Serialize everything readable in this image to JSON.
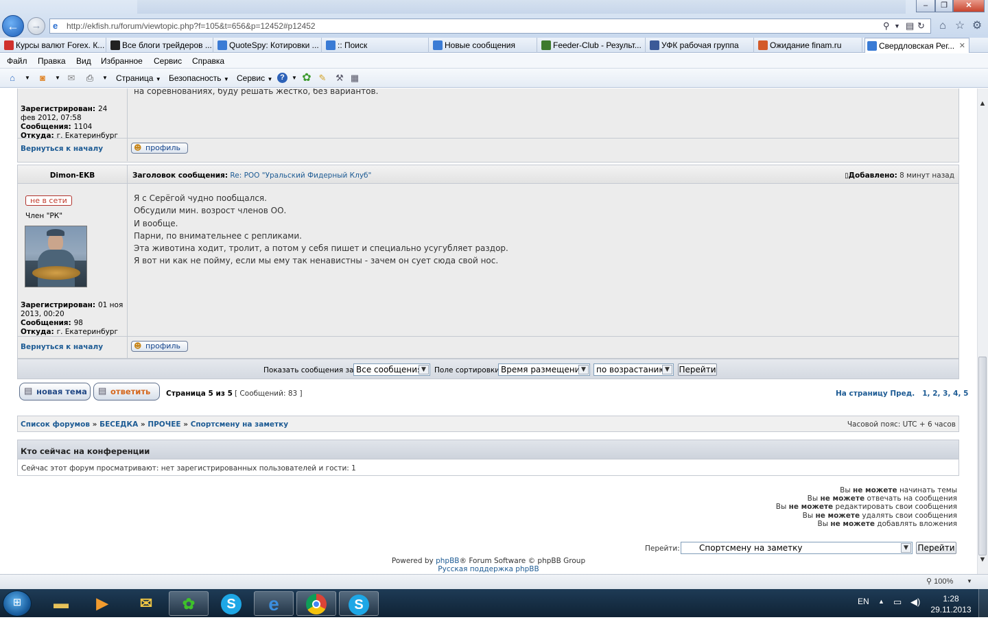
{
  "browser": {
    "url": "http://ekfish.ru/forum/viewtopic.php?f=105&t=656&p=12452#p12452",
    "window_buttons": [
      "–",
      "❐",
      "✕"
    ]
  },
  "favorites": [
    {
      "label": "Курсы валют Forex. К...",
      "color": "#d0312d"
    },
    {
      "label": "Все блоги трейдеров ...",
      "color": "#222222"
    },
    {
      "label": "QuoteSpy: Котировки ...",
      "color": "#3a7bd5"
    },
    {
      "label": ":: Поиск",
      "color": "#3a7bd5"
    },
    {
      "label": "Новые сообщения",
      "color": "#3a7bd5"
    },
    {
      "label": "Feeder-Club - Результ...",
      "color": "#3d7a2c"
    },
    {
      "label": "УФК рабочая группа",
      "color": "#3b5998"
    },
    {
      "label": "Ожидание finam.ru",
      "color": "#d35a2a"
    },
    {
      "label": "Свердловская Рег...",
      "color": "#3a7bd5"
    }
  ],
  "menu": [
    "Файл",
    "Правка",
    "Вид",
    "Избранное",
    "Сервис",
    "Справка"
  ],
  "commands": [
    "Страница",
    "Безопасность",
    "Сервис"
  ],
  "post1": {
    "body_tail": "на соревнованиях, буду решать жёстко, без вариантов.",
    "registered_label": "Зарегистрирован:",
    "registered_value": "24 фев 2012, 07:58",
    "posts_label": "Сообщения:",
    "posts_value": "1104",
    "from_label": "Откуда:",
    "from_value": "г. Екатеринбург",
    "back_to_top": "Вернуться к началу",
    "profile_btn": "профиль"
  },
  "post2": {
    "author": "Dimon-EKB",
    "subject_label": "Заголовок сообщения:",
    "subject_value": "Re: РОО \"Уральский Фидерный Клуб\"",
    "added_label": "Добавлено:",
    "added_value": "8 минут назад",
    "status": "не в сети",
    "rank": "Член \"РК\"",
    "lines": [
      "Я с Серёгой чудно пообщался.",
      "Обсудили мин. возрост членов ОО.",
      "И вообще.",
      "Парни, по внимательнее с репликами.",
      "Эта животина ходит, тролит, а потом у себя пишет и специально усугубляет раздор.",
      "Я вот ни как не пойму, если мы ему так ненавистны - зачем он сует сюда свой нос."
    ],
    "registered_label": "Зарегистрирован:",
    "registered_value": "01 ноя 2013, 00:20",
    "posts_label": "Сообщения:",
    "posts_value": "98",
    "from_label": "Откуда:",
    "from_value": "г. Екатеринбург",
    "back_to_top": "Вернуться к началу",
    "profile_btn": "профиль"
  },
  "sortbar": {
    "show_label": "Показать сообщения за:",
    "show_value": "Все сообщения",
    "sort_label": "Поле сортировки",
    "sort_value": "Время размещения",
    "order_value": "по возрастанию",
    "go": "Перейти"
  },
  "pagination": {
    "new_topic": "новая тема",
    "reply": "ответить",
    "page_info": "Страница 5 из 5",
    "posts_count": "[ Сообщений: 83 ]",
    "goto_label": "На страницу",
    "prev": "Пред.",
    "pages": [
      "1",
      "2",
      "3",
      "4",
      "5"
    ]
  },
  "breadcrumb": {
    "items": [
      "Список форумов",
      "БЕСЕДКА",
      "ПРОЧЕЕ",
      "Спортсмену на заметку"
    ],
    "separator": "»",
    "timezone": "Часовой пояс: UTC + 6 часов"
  },
  "whois": {
    "title": "Кто сейчас на конференции",
    "text": "Сейчас этот форум просматривают: нет зарегистрированных пользователей и гости: 1"
  },
  "permissions": [
    {
      "pre": "Вы",
      "strong": "не можете",
      "post": "начинать темы"
    },
    {
      "pre": "Вы",
      "strong": "не можете",
      "post": "отвечать на сообщения"
    },
    {
      "pre": "Вы",
      "strong": "не можете",
      "post": "редактировать свои сообщения"
    },
    {
      "pre": "Вы",
      "strong": "не можете",
      "post": "удалять свои сообщения"
    },
    {
      "pre": "Вы",
      "strong": "не можете",
      "post": "добавлять вложения"
    }
  ],
  "jumpbox": {
    "label": "Перейти:",
    "value": "Спортсмену на заметку",
    "go": "Перейти"
  },
  "footer": {
    "powered_pre": "Powered by",
    "phpbb": "phpBB",
    "powered_post": "® Forum Software © phpBB Group",
    "support": "Русская поддержка phpBB"
  },
  "status": {
    "zoom": "100%"
  },
  "taskbar": {
    "lang": "EN",
    "time": "1:28",
    "date": "29.11.2013"
  }
}
